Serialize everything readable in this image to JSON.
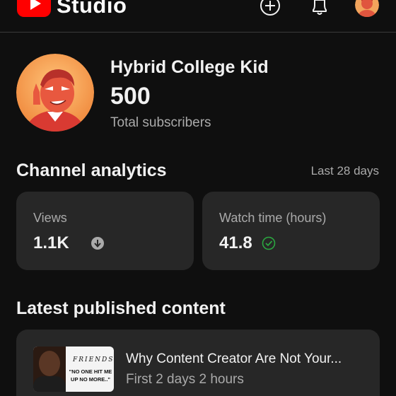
{
  "header": {
    "brand": "Studio",
    "logo_icon": "youtube-play-icon",
    "create_icon": "create-plus-icon",
    "notifications_icon": "bell-icon",
    "account_icon": "account-avatar"
  },
  "profile": {
    "channel_name": "Hybrid College Kid",
    "subscriber_count": "500",
    "subscriber_label": "Total subscribers"
  },
  "analytics": {
    "title": "Channel analytics",
    "period": "Last 28 days",
    "views": {
      "label": "Views",
      "value": "1.1K",
      "trend_icon": "arrow-down-circle-icon"
    },
    "watch_time": {
      "label": "Watch time (hours)",
      "value": "41.8",
      "trend_icon": "check-circle-icon"
    }
  },
  "latest": {
    "title": "Latest published content",
    "video": {
      "title": "Why Content Creator Are Not Your...",
      "meta": "First 2 days 2 hours",
      "thumb_brand": "FRIENDS",
      "thumb_caption": "\"NO ONE HIT ME UP NO MORE..\""
    }
  },
  "colors": {
    "background": "#0f0f0f",
    "card": "#272727",
    "brand_red": "#ff0000",
    "secondary_text": "#aaaaaa",
    "success_green": "#2ba640"
  }
}
